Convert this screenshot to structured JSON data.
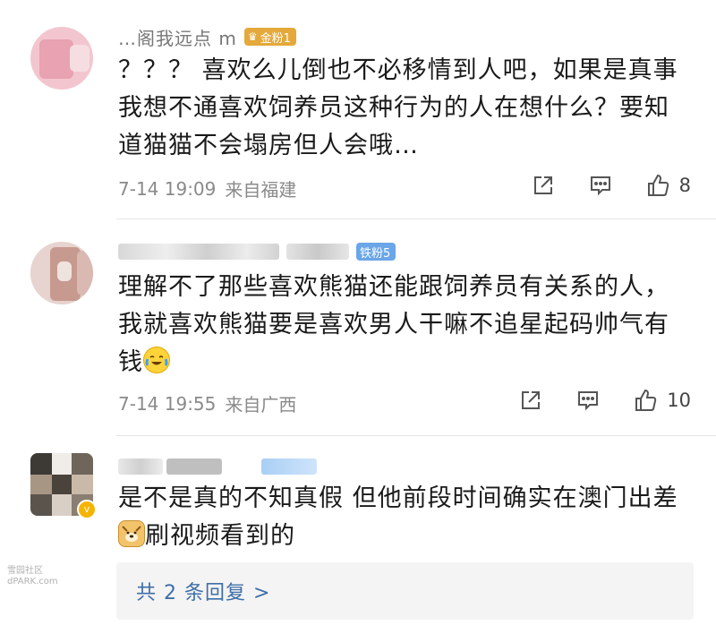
{
  "colors": {
    "link_blue": "#3f6ea8",
    "badge_gold": "#e4a93a",
    "badge_blue": "#6aa6e8",
    "meta_gray": "#8a8a8a"
  },
  "comments": [
    {
      "username": "…阁我远点 m",
      "badge": {
        "label": "金粉1",
        "icon": "fan-badge-icon"
      },
      "text": "？？？ 喜欢么儿倒也不必移情到人吧，如果是真事我想不通喜欢饲养员这种行为的人在想什么？要知道猫猫不会塌房但人会哦…",
      "time": "7-14 19:09",
      "location": "来自福建",
      "likes": "8"
    },
    {
      "username": "",
      "badge": {
        "label": "铁粉5"
      },
      "text": "理解不了那些喜欢熊猫还能跟饲养员有关系的人，我就喜欢熊猫要是喜欢男人干嘛不追星起码帅气有钱",
      "emoji": "laugh-cry-emoji",
      "time": "7-14 19:55",
      "location": "来自广西",
      "likes": "10"
    },
    {
      "username": "",
      "text_a": "是不是真的不知真假  但他前段时间确实在澳门出差",
      "emoji": "doge-emoji",
      "text_b": "刷视频看到的"
    }
  ],
  "replies": {
    "label": "共 2 条回复 >"
  },
  "watermark": {
    "line1": "雪园社区",
    "line2": "dPARK.com"
  }
}
